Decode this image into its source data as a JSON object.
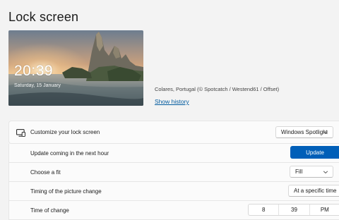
{
  "page": {
    "title": "Lock screen"
  },
  "preview": {
    "time": "20:39",
    "date": "Saturday, 15 January",
    "credit": "Colares, Portugal (© Spotcatch / Westend61 / Offset)",
    "history_link": "Show history"
  },
  "settings": {
    "customize": {
      "label": "Customize your lock screen",
      "icon": "monitor-icon",
      "value": "Windows Spotlight"
    },
    "update": {
      "label": "Update coming in the next hour",
      "button": "Update"
    },
    "fit": {
      "label": "Choose a fit",
      "value": "Fill"
    },
    "timing": {
      "label": "Timing of the picture change",
      "value": "At a specific time"
    },
    "time_of_change": {
      "label": "Time of change",
      "hour": "8",
      "minute": "39",
      "period": "PM"
    }
  },
  "colors": {
    "accent": "#005fb8",
    "link": "#005a9e",
    "background": "#f3f3f3",
    "card": "#fbfbfb"
  }
}
